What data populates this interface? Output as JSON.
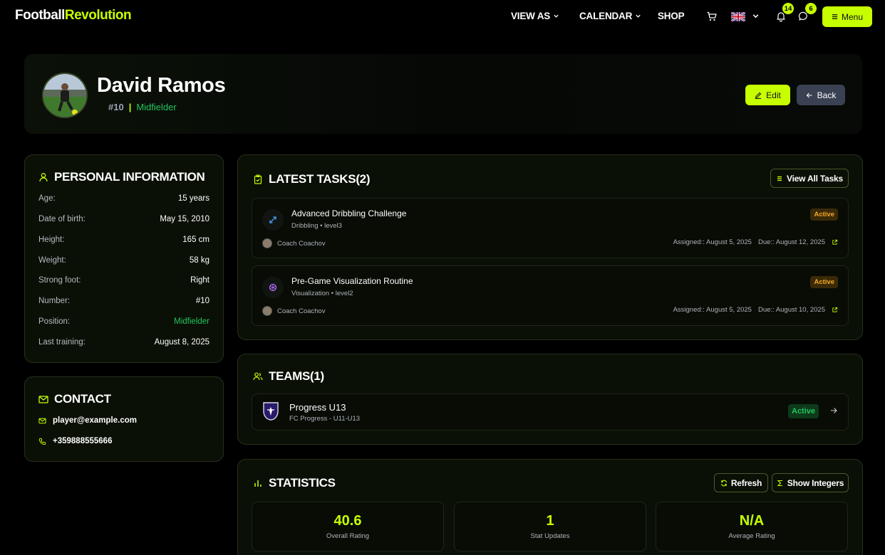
{
  "brand": {
    "part1": "Football",
    "part2": "Revolution"
  },
  "nav": {
    "view_as": "VIEW AS",
    "calendar": "CALENDAR",
    "shop": "SHOP",
    "notifications_count": "14",
    "messages_count": "6",
    "menu_label": "Menu",
    "language_icon": "uk-flag-icon"
  },
  "player": {
    "name": "David Ramos",
    "number": "#10",
    "separator": "|",
    "position": "Midfielder",
    "edit_label": "Edit",
    "back_label": "Back"
  },
  "personal": {
    "title": "PERSONAL INFORMATION",
    "rows": [
      {
        "label": "Age:",
        "value": "15 years"
      },
      {
        "label": "Date of birth:",
        "value": "May 15, 2010"
      },
      {
        "label": "Height:",
        "value": "165 cm"
      },
      {
        "label": "Weight:",
        "value": "58 kg"
      },
      {
        "label": "Strong foot:",
        "value": "Right"
      },
      {
        "label": "Number:",
        "value": "#10"
      },
      {
        "label": "Position:",
        "value": "Midfielder"
      },
      {
        "label": "Last training:",
        "value": "August 8, 2025"
      }
    ]
  },
  "contact": {
    "title": "CONTACT",
    "email": "player@example.com",
    "phone": "+359888555666"
  },
  "tasks": {
    "title": "LATEST TASKS(2)",
    "view_all": "View All Tasks",
    "items": [
      {
        "title": "Advanced Dribbling Challenge",
        "sub": "Dribbling • level3",
        "coach": "Coach Coachov",
        "assigned": "Assigned:: August 5, 2025",
        "due": "Due:: August 12, 2025",
        "status": "Active",
        "icon": "dribbling-icon"
      },
      {
        "title": "Pre-Game Visualization Routine",
        "sub": "Visualization • level2",
        "coach": "Coach Coachov",
        "assigned": "Assigned:: August 5, 2025",
        "due": "Due:: August 10, 2025",
        "status": "Active",
        "icon": "visualization-icon"
      }
    ]
  },
  "teams": {
    "title": "TEAMS(1)",
    "items": [
      {
        "name": "Progress U13",
        "sub": "FC Progress - U11-U13",
        "status": "Active"
      }
    ]
  },
  "statistics": {
    "title": "STATISTICS",
    "refresh": "Refresh",
    "show_integers": "Show Integers",
    "items": [
      {
        "value": "40.6",
        "label": "Overall Rating"
      },
      {
        "value": "1",
        "label": "Stat Updates"
      },
      {
        "value": "N/A",
        "label": "Average Rating"
      }
    ]
  },
  "colors": {
    "accent": "#c6ff00",
    "green": "#22c55e",
    "orange": "#f5a623"
  }
}
